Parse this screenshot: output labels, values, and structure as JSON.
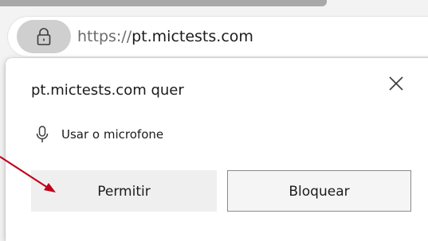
{
  "address_bar": {
    "url_scheme": "https://",
    "url_host": "pt.mictests.com",
    "lock_icon": "lock-icon"
  },
  "permission_prompt": {
    "title": "pt.mictests.com quer",
    "permission_icon": "microphone-icon",
    "permission_label": "Usar o microfone",
    "allow_label": "Permitir",
    "block_label": "Bloquear",
    "close_icon": "close-icon"
  },
  "annotation": {
    "arrow_color": "#c0001a"
  }
}
